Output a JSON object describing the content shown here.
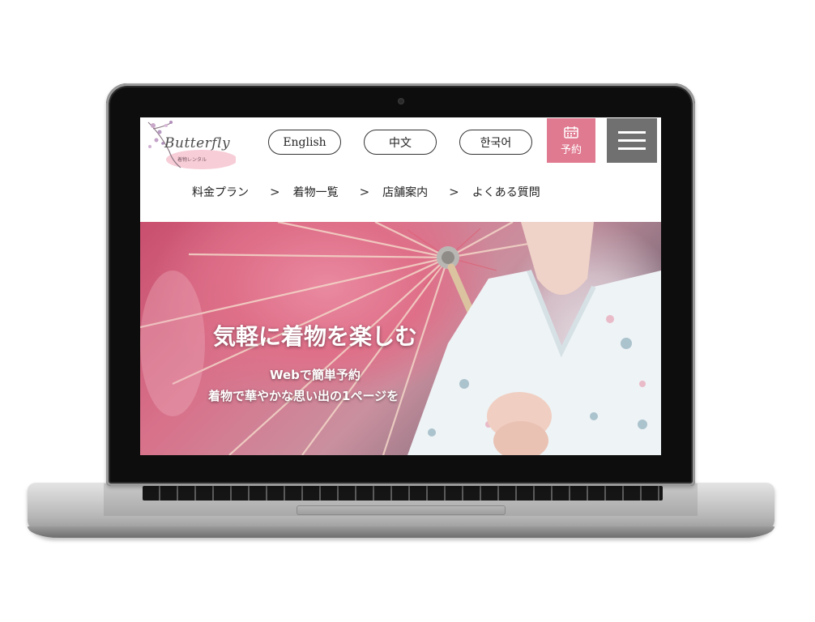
{
  "logo": {
    "script_text": "Butterfly",
    "sub_text": "着物レンタル"
  },
  "languages": [
    {
      "label": "English"
    },
    {
      "label": "中文"
    },
    {
      "label": "한국어"
    }
  ],
  "reserve": {
    "label": "予約",
    "icon": "calendar-icon",
    "color": "#e07a90"
  },
  "menu": {
    "icon": "hamburger-icon",
    "color": "#707070"
  },
  "nav": {
    "items": [
      {
        "label": "料金プラン"
      },
      {
        "label": "着物一覧"
      },
      {
        "label": "店舗案内"
      },
      {
        "label": "よくある質問"
      }
    ],
    "separator": ">"
  },
  "hero": {
    "title": "気軽に着物を楽しむ",
    "sub_line1": "Webで簡単予約",
    "sub_line2": "着物で華やかな思い出の1ページを"
  }
}
